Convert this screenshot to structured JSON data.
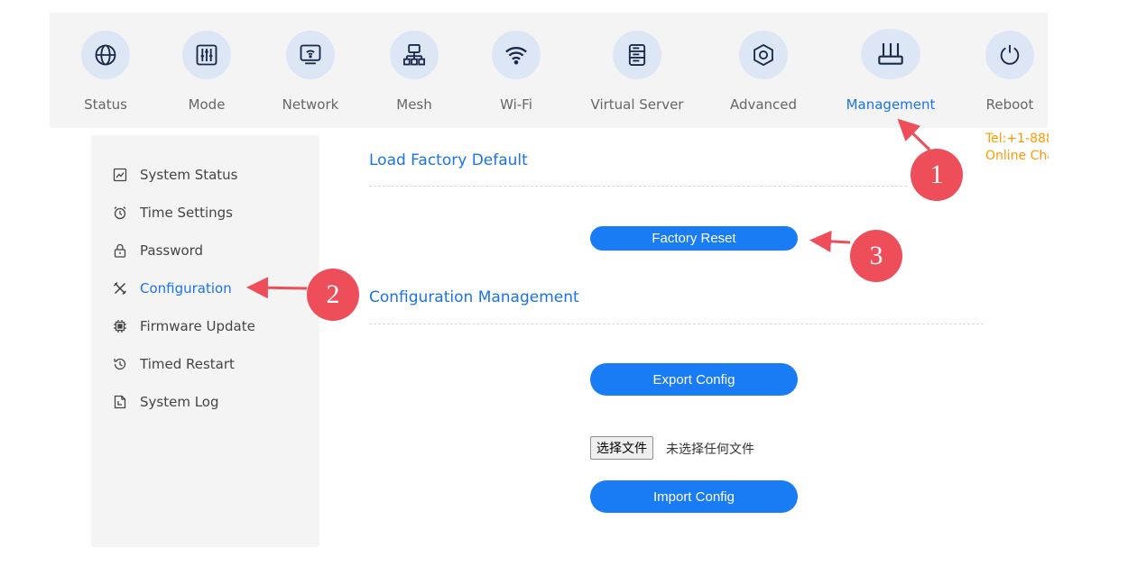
{
  "nav": {
    "items": [
      {
        "label": "Status",
        "icon": "globe-icon"
      },
      {
        "label": "Mode",
        "icon": "sliders-icon"
      },
      {
        "label": "Network",
        "icon": "monitor-wifi-icon"
      },
      {
        "label": "Mesh",
        "icon": "mesh-topology-icon"
      },
      {
        "label": "Wi-Fi",
        "icon": "wifi-icon"
      },
      {
        "label": "Virtual Server",
        "icon": "server-icon"
      },
      {
        "label": "Advanced",
        "icon": "hexagon-icon"
      },
      {
        "label": "Management",
        "icon": "router-icon"
      },
      {
        "label": "Reboot",
        "icon": "power-icon"
      }
    ],
    "active": "Management"
  },
  "contact": {
    "tel": "Tel:+1-888",
    "online": "Online Chat"
  },
  "sidebar": {
    "items": [
      {
        "label": "System Status",
        "icon": "chart-icon"
      },
      {
        "label": "Time Settings",
        "icon": "alarm-clock-icon"
      },
      {
        "label": "Password",
        "icon": "lock-icon"
      },
      {
        "label": "Configuration",
        "icon": "tools-icon"
      },
      {
        "label": "Firmware Update",
        "icon": "chip-icon"
      },
      {
        "label": "Timed Restart",
        "icon": "history-icon"
      },
      {
        "label": "System Log",
        "icon": "document-icon"
      }
    ],
    "active": "Configuration"
  },
  "main": {
    "factory_title": "Load Factory Default",
    "factory_reset_label": "Factory Reset",
    "config_title": "Configuration Management",
    "export_label": "Export Config",
    "file_button_label": "选择文件",
    "file_status": "未选择任何文件",
    "import_label": "Import Config"
  },
  "annotations": {
    "badge1": "1",
    "badge2": "2",
    "badge3": "3"
  },
  "colors": {
    "accent": "#1a73e8",
    "button": "#1a7cf5",
    "badge": "#ee4d5a",
    "contact": "#ff9900"
  }
}
